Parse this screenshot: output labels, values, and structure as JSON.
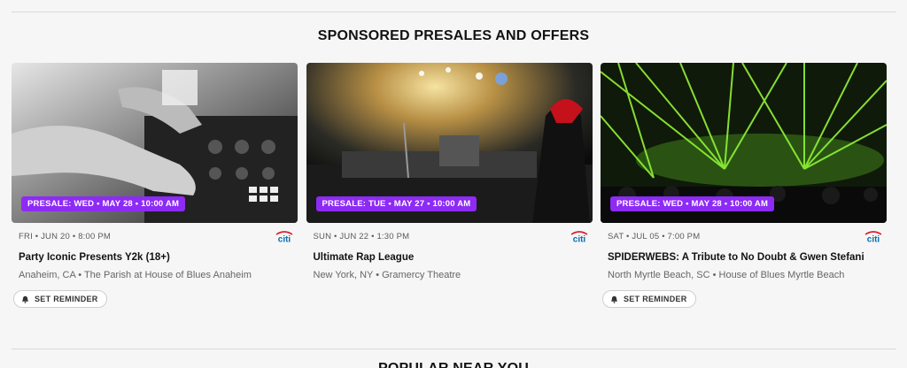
{
  "section": {
    "title": "SPONSORED PRESALES AND OFFERS"
  },
  "next_section": {
    "title": "POPULAR NEAR YOU"
  },
  "sponsor": {
    "logo_text": "citi",
    "logo_color": "#056dae",
    "logo_arc_color": "#d81e2d"
  },
  "badge_color": "#8d2bf5",
  "cards": [
    {
      "presale": "PRESALE: WED • MAY 28 • 10:00 AM",
      "date": "FRI • JUN 20 • 8:00 PM",
      "title": "Party Iconic Presents Y2k (18+)",
      "venue": "Anaheim, CA • The Parish at House of Blues Anaheim",
      "reminder": "SET REMINDER"
    },
    {
      "presale": "PRESALE: TUE • MAY 27 • 10:00 AM",
      "date": "SUN • JUN 22 • 1:30 PM",
      "title": "Ultimate Rap League",
      "venue": "New York, NY • Gramercy Theatre"
    },
    {
      "presale": "PRESALE: WED • MAY 28 • 10:00 AM",
      "date": "SAT • JUL 05 • 7:00 PM",
      "title": "SPIDERWEBS: A Tribute to No Doubt & Gwen Stefani",
      "venue": "North Myrtle Beach, SC • House of Blues Myrtle Beach",
      "reminder": "SET REMINDER"
    }
  ]
}
